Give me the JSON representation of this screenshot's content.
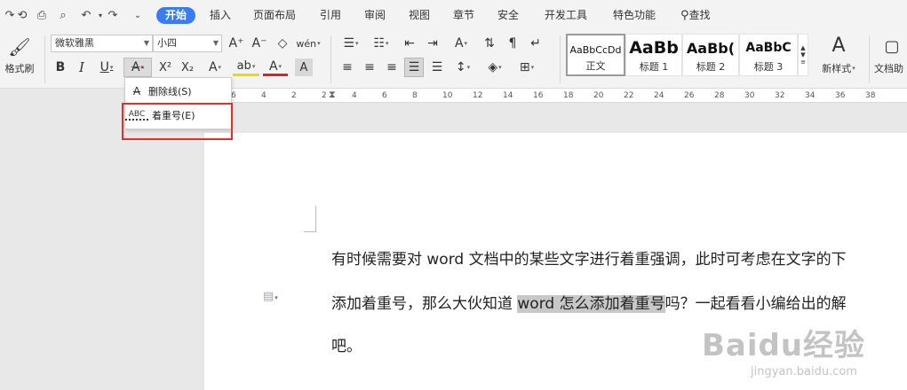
{
  "menubar": {
    "tabs": [
      "开始",
      "插入",
      "页面布局",
      "引用",
      "审阅",
      "视图",
      "章节",
      "安全",
      "开发工具",
      "特色功能",
      "查找"
    ]
  },
  "ribbon": {
    "format_painter": "格式刷",
    "font_name": "微软雅黑",
    "font_size": "小四",
    "styles": [
      {
        "sample": "AaBbCcDd",
        "name": "正文"
      },
      {
        "sample": "AaBb",
        "name": "标题 1"
      },
      {
        "sample": "AaBb(",
        "name": "标题 2"
      },
      {
        "sample": "AaBbC",
        "name": "标题 3"
      }
    ],
    "new_style": "新样式",
    "doc_helper": "文档助"
  },
  "dropdown": {
    "strikethrough": "删除线(S)",
    "emphasis": "着重号(E)",
    "emphasis_icon_text": "ABC"
  },
  "ruler": {
    "ticks": [
      "6",
      "4",
      "2",
      "2",
      "4",
      "6",
      "8",
      "10",
      "12",
      "14",
      "16",
      "18",
      "20",
      "22",
      "24",
      "26",
      "28",
      "30",
      "32",
      "34",
      "36",
      "38"
    ]
  },
  "document": {
    "line1": "有时候需要对 word 文档中的某些文字进行着重强调，此时可考虑在文字的下",
    "line2_a": "添加着重号，那么大伙知道 ",
    "line2_hl": "word 怎么添加着重号",
    "line2_b": "吗？一起看看小编给出的解",
    "line3": "吧。"
  },
  "watermark": {
    "main": "Baidu经验",
    "sub": "jingyan.baidu.com"
  }
}
